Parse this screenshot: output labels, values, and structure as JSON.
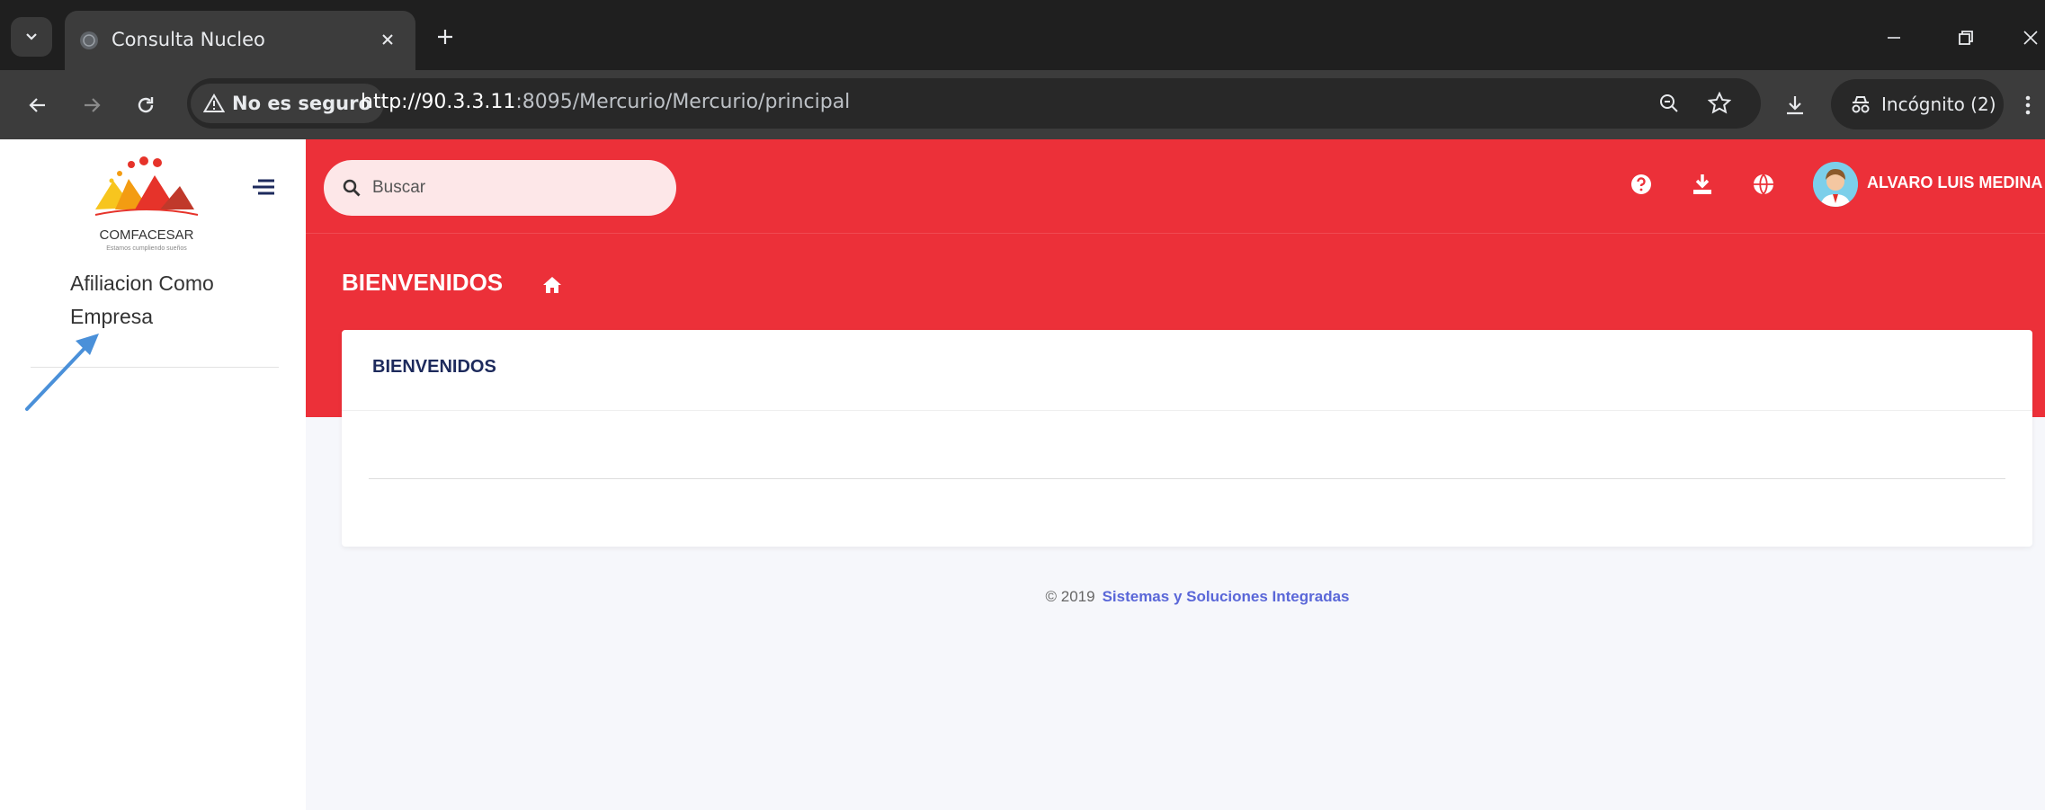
{
  "browser": {
    "tab_title": "Consulta Nucleo",
    "security_label": "No es seguro",
    "url_host": "http://90.3.3.11",
    "url_rest": ":8095/Mercurio/Mercurio/principal",
    "incognito_label": "Incógnito (2)"
  },
  "sidebar": {
    "logo_text": "COMFACESAR",
    "logo_slogan": "Estamos cumpliendo sueños",
    "menu_item": "Afiliacion Como Empresa"
  },
  "header": {
    "search_placeholder": "Buscar",
    "user_name": "ALVARO LUIS MEDINA"
  },
  "page": {
    "title": "BIENVENIDOS",
    "card_title": "BIENVENIDOS"
  },
  "footer": {
    "copyright": "© 2019",
    "company_link": "Sistemas y Soluciones Integradas"
  },
  "colors": {
    "brand_red": "#ec3039",
    "card_title": "#1d2a5c",
    "footer_link": "#5a67d8",
    "annotation_arrow": "#4a90d9"
  }
}
